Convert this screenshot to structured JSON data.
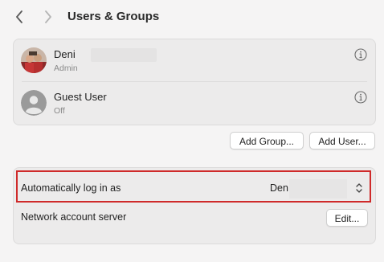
{
  "window": {
    "title": "Users & Groups"
  },
  "users": [
    {
      "name": "Deni",
      "role": "Admin",
      "avatar": "photo"
    },
    {
      "name": "Guest User",
      "role": "Off",
      "avatar": "generic-person-icon"
    }
  ],
  "buttons": {
    "add_group": "Add Group...",
    "add_user": "Add User...",
    "edit": "Edit..."
  },
  "settings": {
    "auto_login_label": "Automatically log in as",
    "auto_login_value": "Den",
    "network_server_label": "Network account server"
  },
  "colors": {
    "highlight": "#cf2a2a",
    "background": "#f5f4f4",
    "panel": "#ecebeb"
  },
  "icons": [
    "chevron-left-icon",
    "chevron-right-icon",
    "info-icon",
    "updown-chevron-icon"
  ]
}
